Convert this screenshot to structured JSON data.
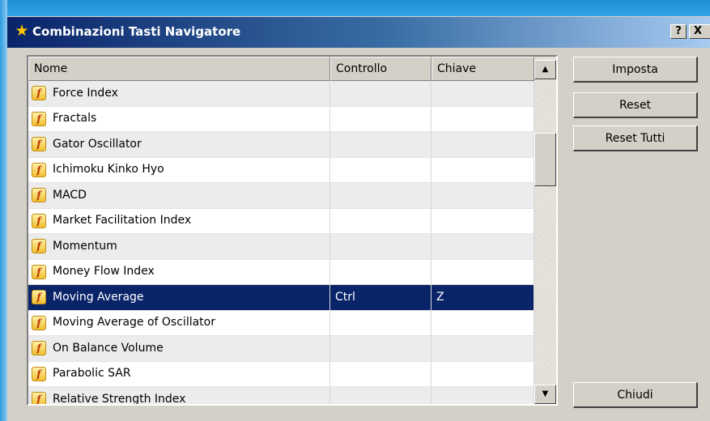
{
  "window": {
    "title": "Combinazioni Tasti Navigatore",
    "title_icon": "★",
    "help_label": "?",
    "close_label": "X"
  },
  "table": {
    "columns": [
      "Nome",
      "Controllo",
      "Chiave"
    ],
    "rows": [
      {
        "name": "Force Index",
        "control": "",
        "key": ""
      },
      {
        "name": "Fractals",
        "control": "",
        "key": ""
      },
      {
        "name": "Gator Oscillator",
        "control": "",
        "key": ""
      },
      {
        "name": "Ichimoku Kinko Hyo",
        "control": "",
        "key": ""
      },
      {
        "name": "MACD",
        "control": "",
        "key": ""
      },
      {
        "name": "Market Facilitation Index",
        "control": "",
        "key": ""
      },
      {
        "name": "Momentum",
        "control": "",
        "key": ""
      },
      {
        "name": "Money Flow Index",
        "control": "",
        "key": ""
      },
      {
        "name": "Moving Average",
        "control": "Ctrl",
        "key": "Z"
      },
      {
        "name": "Moving Average of Oscillator",
        "control": "",
        "key": ""
      },
      {
        "name": "On Balance Volume",
        "control": "",
        "key": ""
      },
      {
        "name": "Parabolic SAR",
        "control": "",
        "key": ""
      },
      {
        "name": "Relative Strength Index",
        "control": "",
        "key": ""
      }
    ],
    "selected_row": "Moving Average",
    "row_icon_glyph": "f"
  },
  "scrollbar": {
    "up_glyph": "▲",
    "down_glyph": "▼"
  },
  "buttons": {
    "imposta": "Imposta",
    "reset": "Reset",
    "reset_all": "Reset Tutti",
    "close": "Chiudi"
  },
  "colors": {
    "selection": "#0a246a",
    "title_bar_start": "#0a246a",
    "dialog_face": "#d4d0c8"
  }
}
